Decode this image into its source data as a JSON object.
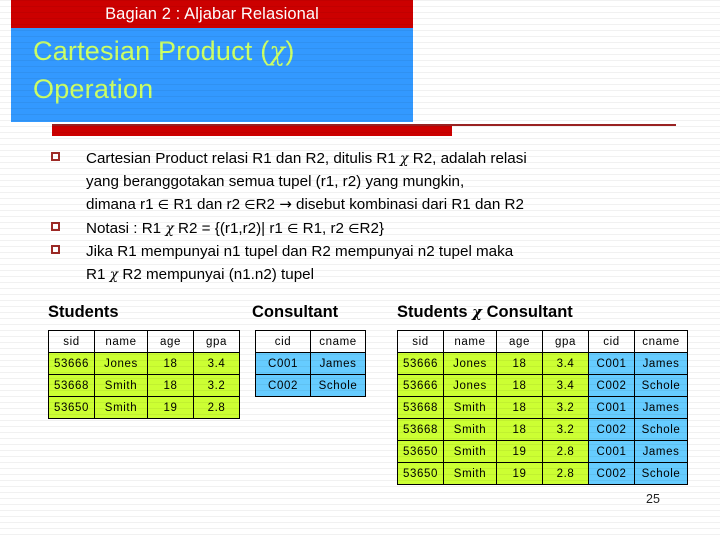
{
  "slide": {
    "header_bar_title": "Bagian 2 : Aljabar Relasional",
    "title_line1": "Cartesian Product (",
    "title_chi": "χ",
    "title_line1_end": ")",
    "title_line2": "Operation",
    "page_number": "25",
    "colors": {
      "header_red": "#CC0000",
      "title_blue": "#3399FF",
      "title_yellow_green": "#CCFF66",
      "rule_dark_red": "#992222",
      "bullet_marker": "#9E2A26",
      "cell_green": "#CCFF33",
      "cell_blue": "#66CCFF"
    }
  },
  "bullets": [
    {
      "lines": [
        {
          "parts": [
            {
              "t": "Cartesian Product relasi R1 dan R2, ditulis R1 "
            },
            {
              "t": "χ",
              "s": "chi"
            },
            {
              "t": " R2, adalah relasi"
            }
          ]
        },
        {
          "parts": [
            {
              "t": "yang beranggotakan semua tupel (r1, r2) yang mungkin,"
            }
          ]
        },
        {
          "parts": [
            {
              "t": "dimana r1 "
            },
            {
              "t": "∈",
              "s": "sym"
            },
            {
              "t": " R1 dan r2 "
            },
            {
              "t": "∈",
              "s": "sym"
            },
            {
              "t": "R2 "
            },
            {
              "t": "→",
              "s": "arrow"
            },
            {
              "t": " disebut kombinasi dari R1 dan R2"
            }
          ]
        }
      ]
    },
    {
      "lines": [
        {
          "parts": [
            {
              "t": "Notasi : R1 "
            },
            {
              "t": "χ",
              "s": "chi"
            },
            {
              "t": " R2 = {(r1,r2)| r1 "
            },
            {
              "t": "∈",
              "s": "sym"
            },
            {
              "t": " R1, r2 "
            },
            {
              "t": "∈",
              "s": "sym"
            },
            {
              "t": "R2}"
            }
          ]
        }
      ]
    },
    {
      "lines": [
        {
          "parts": [
            {
              "t": "Jika R1 mempunyai n1 tupel dan R2 mempunyai n2 tupel maka"
            }
          ]
        },
        {
          "parts": [
            {
              "t": "R1 "
            },
            {
              "t": "χ",
              "s": "chi"
            },
            {
              "t": " R2 mempunyai (n1.n2) tupel"
            }
          ]
        }
      ]
    }
  ],
  "tables": {
    "students": {
      "caption": "Students",
      "columns": [
        "sid",
        "name",
        "age",
        "gpa"
      ],
      "rows": [
        [
          "53666",
          "Jones",
          "18",
          "3.4"
        ],
        [
          "53668",
          "Smith",
          "18",
          "3.2"
        ],
        [
          "53650",
          "Smith",
          "19",
          "2.8"
        ]
      ]
    },
    "consultant": {
      "caption": "Consultant",
      "columns": [
        "cid",
        "cname"
      ],
      "rows": [
        [
          "C001",
          "James"
        ],
        [
          "C002",
          "Schole"
        ]
      ]
    },
    "product": {
      "caption_left": "Students ",
      "caption_chi": "χ",
      "caption_right": " Consultant",
      "columns": [
        "sid",
        "name",
        "age",
        "gpa",
        "cid",
        "cname"
      ],
      "rows": [
        [
          "53666",
          "Jones",
          "18",
          "3.4",
          "C001",
          "James"
        ],
        [
          "53666",
          "Jones",
          "18",
          "3.4",
          "C002",
          "Schole"
        ],
        [
          "53668",
          "Smith",
          "18",
          "3.2",
          "C001",
          "James"
        ],
        [
          "53668",
          "Smith",
          "18",
          "3.2",
          "C002",
          "Schole"
        ],
        [
          "53650",
          "Smith",
          "19",
          "2.8",
          "C001",
          "James"
        ],
        [
          "53650",
          "Smith",
          "19",
          "2.8",
          "C002",
          "Schole"
        ]
      ]
    }
  }
}
